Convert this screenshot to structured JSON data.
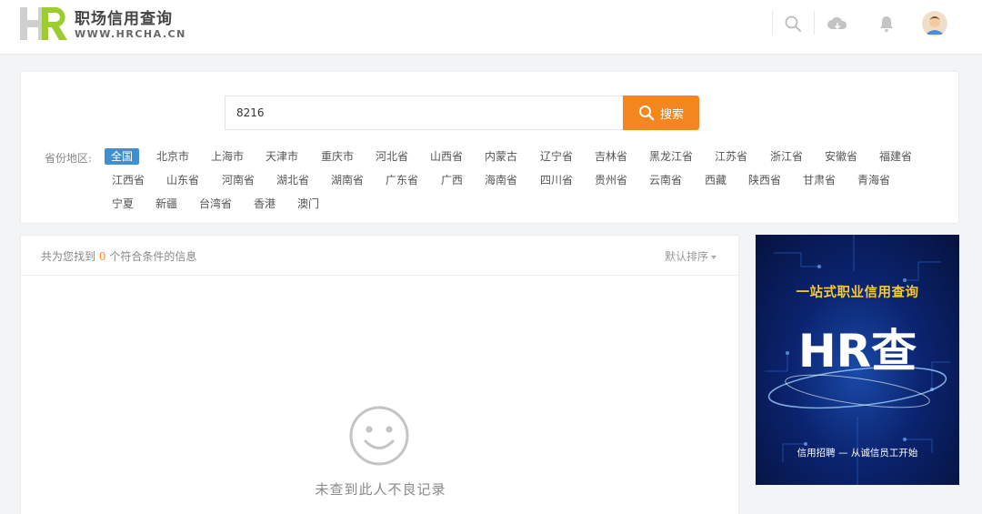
{
  "header": {
    "brand_name": "职场信用查询",
    "brand_url": "WWW.HRCHA.CN",
    "icons": [
      "search-icon",
      "cloud-icon",
      "bell-icon",
      "avatar"
    ]
  },
  "search": {
    "value": "8216",
    "button_label": "搜索"
  },
  "regions": {
    "label": "省份地区:",
    "items": [
      "全国",
      "北京市",
      "上海市",
      "天津市",
      "重庆市",
      "河北省",
      "山西省",
      "内蒙古",
      "辽宁省",
      "吉林省",
      "黑龙江省",
      "江苏省",
      "浙江省",
      "安徽省",
      "福建省",
      "江西省",
      "山东省",
      "河南省",
      "湖北省",
      "湖南省",
      "广东省",
      "广西",
      "海南省",
      "四川省",
      "贵州省",
      "云南省",
      "西藏",
      "陕西省",
      "甘肃省",
      "青海省",
      "宁夏",
      "新疆",
      "台湾省",
      "香港",
      "澳门"
    ],
    "selected": "全国"
  },
  "results": {
    "count_prefix": "共为您找到",
    "count": "0",
    "count_suffix": "个符合条件的信息",
    "sort_label": "默认排序",
    "empty_message": "未查到此人不良记录"
  },
  "ad": {
    "slogan": "一站式职业信用查询",
    "logo_text": "HR查",
    "tagline": "信用招聘 — 从诚信员工开始"
  },
  "colors": {
    "accent": "#f3861f",
    "selected_region": "#3e8fd4",
    "logo_grey": "#c9c9c9",
    "logo_green": "#9ccc2f",
    "ad_yellow": "#f6c832",
    "ad_blue": "#0b2470"
  }
}
